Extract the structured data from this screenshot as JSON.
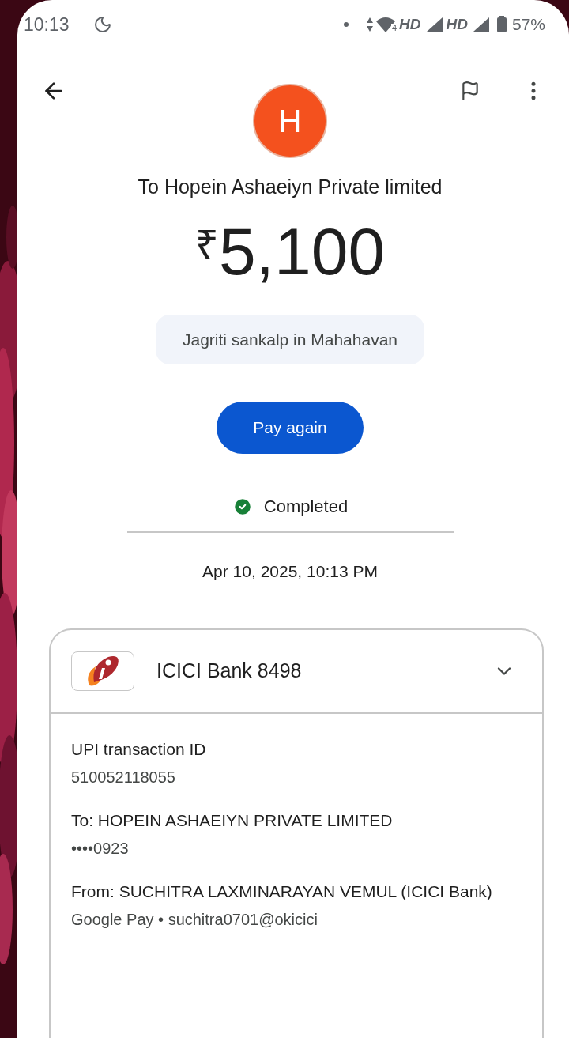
{
  "status_bar": {
    "time": "10:13",
    "wifi_badge": "4",
    "network_labels": [
      "HD",
      "HD"
    ],
    "battery": "57%"
  },
  "payee": {
    "initial": "H",
    "title": "To Hopein Ashaeiyn Private limited"
  },
  "amount": {
    "currency": "₹",
    "value": "5,100"
  },
  "note": "Jagriti sankalp in Mahahavan",
  "pay_again_button": "Pay again",
  "status": {
    "label": "Completed",
    "completed": true
  },
  "date": "Apr 10, 2025, 10:13 PM",
  "bank_card": {
    "bank": "ICICI Bank 8498",
    "expanded": true,
    "details": [
      {
        "label": "UPI transaction ID",
        "value": "510052118055"
      },
      {
        "label": "To: HOPEIN ASHAEIYN PRIVATE LIMITED",
        "value": "••••0923"
      },
      {
        "label": "From: SUCHITRA LAXMINARAYAN VEMUL (ICICI Bank)",
        "value": "Google Pay • suchitra0701@okicici"
      }
    ]
  }
}
